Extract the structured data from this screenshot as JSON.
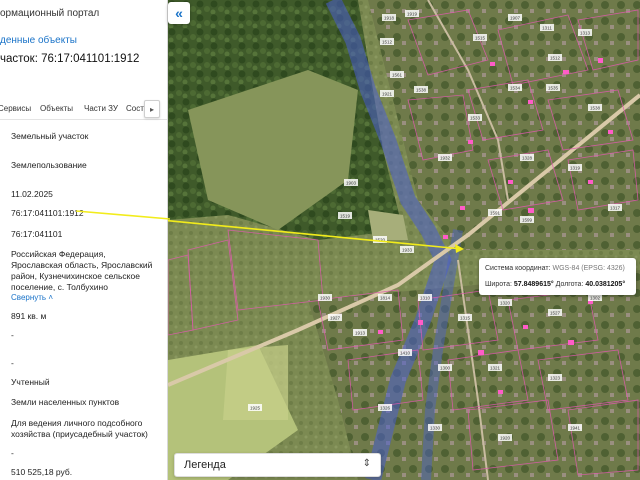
{
  "header": {
    "portal": "ормационный портал",
    "found_link": "денные объекты",
    "parcel_title": "часток: 76:17:041101:1912"
  },
  "tabs": [
    "Сервисы",
    "Объекты",
    "Части ЗУ",
    "Сост"
  ],
  "tab_next_icon": "chevron-right-icon",
  "fields": {
    "object_type": "Земельный участок",
    "kind": "Землепользование",
    "date": "11.02.2025",
    "cad_number": "76:17:041101:1912",
    "quarter": "76:17:041101",
    "address_1": "Российская Федерация,",
    "address_2": "Ярославская область, Ярославский",
    "address_3": "район, Кузнечихинское сельское",
    "address_4": "поселение, с. Толбухино",
    "compare_link": "Свернуть",
    "area": "891 кв. м",
    "dash_1": "-",
    "dash_2": "-",
    "status": "Учтенный",
    "category": "Земли населенных пунктов",
    "use_1": "Для ведения личного подсобного",
    "use_2": "хозяйства (приусадебный участок)",
    "dash_3": "-",
    "price": "510 525,18 руб."
  },
  "map": {
    "collapse_icon": "double-chevron-left-icon",
    "popup": {
      "crs_label": "Система координат:",
      "crs_value": "WGS-84 (EPSG: 4326)",
      "lat_label": "Широта:",
      "lat_value": "57.8489615°",
      "lon_label": "Долгота:",
      "lon_value": "40.0381205°"
    },
    "legend_label": "Легенда",
    "legend_icon": "updown-chevron-icon",
    "parcel_labels": [
      "1918",
      "1919",
      "1512",
      "1538",
      "1903",
      "1519",
      "1520",
      "1933",
      "1921",
      "1561",
      "1515",
      "1907",
      "1311",
      "1313",
      "1512",
      "1534",
      "1535",
      "1538",
      "1533",
      "1328",
      "1319",
      "1317",
      "1591",
      "1599",
      "1932",
      "1930",
      "1927",
      "1913",
      "1814",
      "1310",
      "1315",
      "1320",
      "1527",
      "1302",
      "1410",
      "1300",
      "1321",
      "1323",
      "1326",
      "1330",
      "1920",
      "1941",
      "1925"
    ],
    "colors": {
      "connector": "#f2ec1b",
      "parcel_boundary": "#e05ab0",
      "road_overlay": "#4a5fcf",
      "building": "#ff5cc8"
    }
  }
}
